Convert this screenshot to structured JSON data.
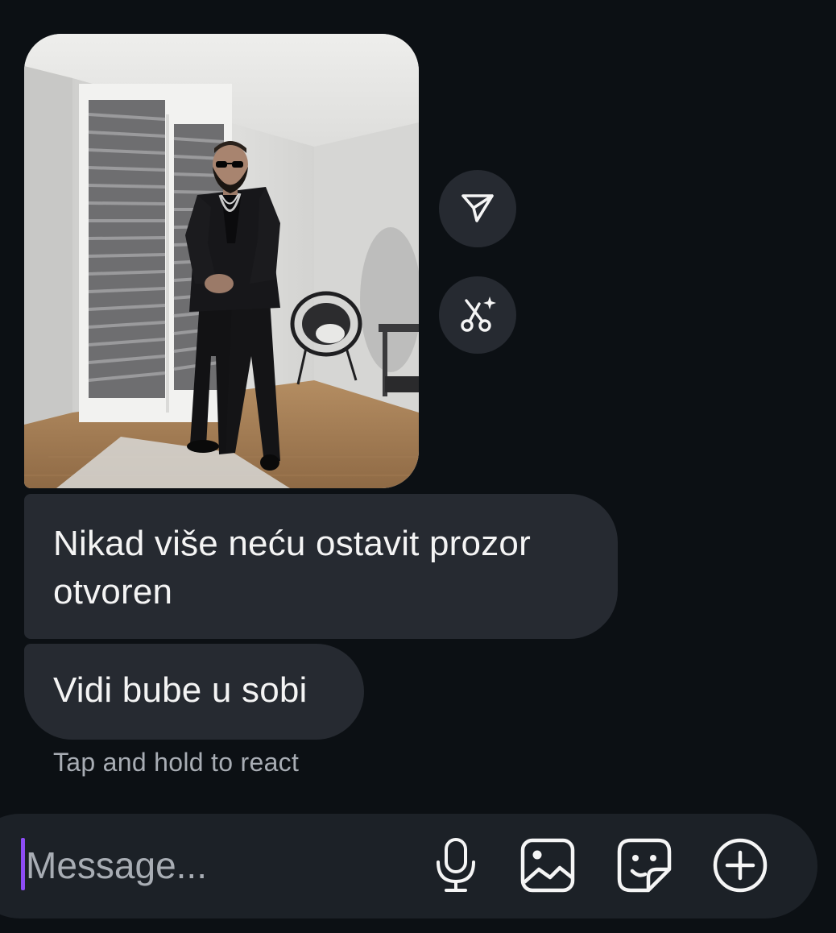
{
  "chat": {
    "photo": {
      "alt": "Photo attachment"
    },
    "actions": {
      "share_icon": "send-icon",
      "remix_icon": "scissors-sparkle-icon"
    },
    "messages": [
      {
        "text": "Nikad više neću ostavit prozor otvoren"
      },
      {
        "text": "Vidi bube u sobi"
      }
    ],
    "react_hint": "Tap and hold to react"
  },
  "composer": {
    "placeholder": "Message...",
    "value": "",
    "icons": [
      "microphone-icon",
      "gallery-icon",
      "sticker-icon",
      "plus-circle-icon"
    ]
  },
  "colors": {
    "background": "#0c1014",
    "bubble": "#262a31",
    "composer": "#1c2127",
    "caret": "#8d4cf5",
    "secondary_text": "#a8adb4"
  }
}
